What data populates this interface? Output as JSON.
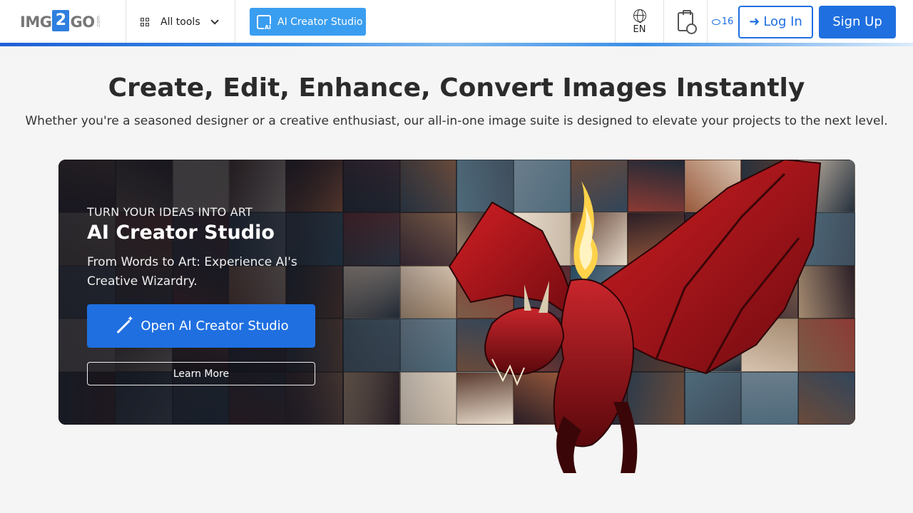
{
  "header": {
    "logo": {
      "left": "IMG",
      "mid": "2",
      "right": "GO",
      "suffix": ".com"
    },
    "all_tools_label": "All tools",
    "ai_studio_label": "AI Creator Studio",
    "language_label": "EN",
    "credits_count": "16",
    "login_label": "Log In",
    "signup_label": "Sign Up"
  },
  "hero": {
    "title": "Create, Edit, Enhance, Convert Images Instantly",
    "subtitle": "Whether you're a seasoned designer or a creative enthusiast, our all-in-one image suite is designed to elevate your projects to the next level."
  },
  "banner": {
    "kicker": "TURN YOUR IDEAS INTO ART",
    "title": "AI Creator Studio",
    "description": "From Words to Art: Experience AI's Creative Wizardry.",
    "primary_button": "Open AI Creator Studio",
    "secondary_button": "Learn More"
  },
  "colors": {
    "brand_blue": "#1f6fe0",
    "ai_button_blue": "#3a9ef0",
    "dragon_red": "#b3141c"
  }
}
